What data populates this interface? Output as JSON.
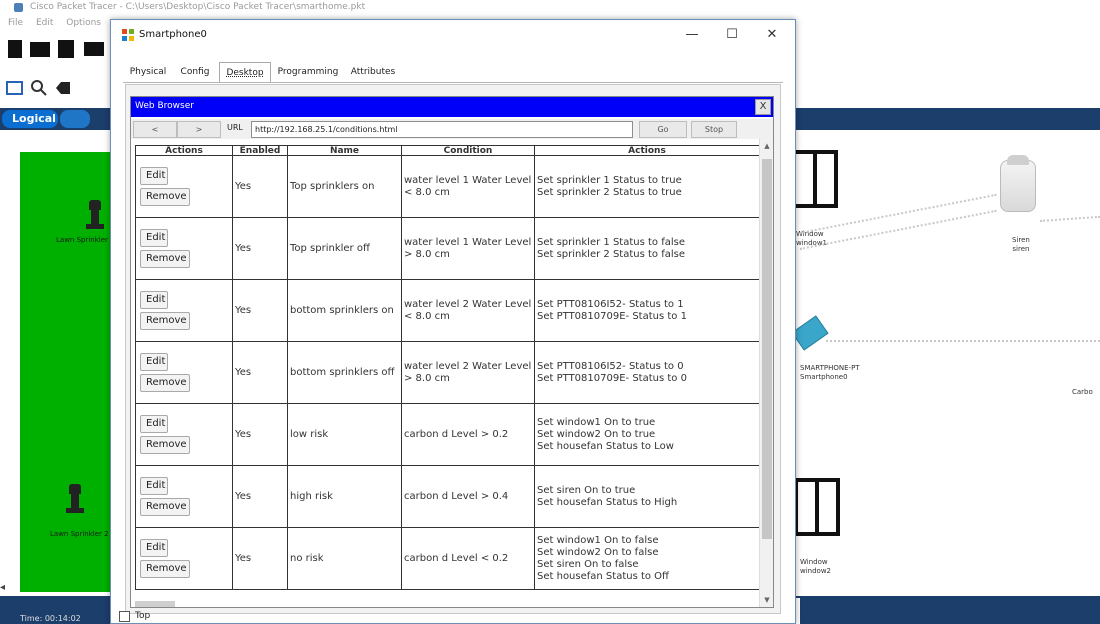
{
  "background": {
    "title_text": "Cisco Packet Tracer - C:\\Users\\Desktop\\Cisco Packet Tracer\\smarthome.pkt",
    "menu": [
      "File",
      "Edit",
      "Options"
    ],
    "logical_tab": "Logical",
    "devices": [
      {
        "label": "Lawn Sprinkler"
      },
      {
        "label": "Lawn Sprinkler 2"
      },
      {
        "label": "Window\nwindow1"
      },
      {
        "label": "Siren\nsiren"
      },
      {
        "label": "SMARTPHONE-PT\nSmartphone0"
      },
      {
        "label": "Carbo"
      },
      {
        "label": "Window\nwindow2"
      }
    ],
    "time_label": "Time: 00:14:02"
  },
  "window": {
    "title": "Smartphone0",
    "controls": {
      "minimize": "—",
      "maximize": "☐",
      "close": "✕"
    },
    "tabs": [
      "Physical",
      "Config",
      "Desktop",
      "Programming",
      "Attributes"
    ],
    "active_tab": "Desktop",
    "top_checkbox_label": "Top"
  },
  "browser": {
    "title": "Web Browser",
    "close": "X",
    "nav": {
      "back": "<",
      "forward": ">",
      "url_label": "URL",
      "go": "Go",
      "stop": "Stop"
    },
    "url": "http://192.168.25.1/conditions.html",
    "columns": [
      "Actions",
      "Enabled",
      "Name",
      "Condition",
      "Actions"
    ],
    "edit_label": "Edit",
    "remove_label": "Remove",
    "rules": [
      {
        "enabled": "Yes",
        "name": "Top sprinklers on",
        "condition": "water level 1 Water Level < 8.0 cm",
        "actions": "Set sprinkler 1 Status to true\nSet sprinkler 2 Status to true"
      },
      {
        "enabled": "Yes",
        "name": "Top sprinkler off",
        "condition": "water level 1 Water Level > 8.0 cm",
        "actions": "Set sprinkler 1 Status to false\nSet sprinkler 2 Status to false"
      },
      {
        "enabled": "Yes",
        "name": "bottom sprinklers on",
        "condition": "water level 2 Water Level < 8.0 cm",
        "actions": "Set PTT08106I52- Status to 1\nSet PTT0810709E- Status to 1"
      },
      {
        "enabled": "Yes",
        "name": "bottom sprinklers off",
        "condition": "water level 2 Water Level > 8.0 cm",
        "actions": "Set PTT08106I52- Status to 0\nSet PTT0810709E- Status to 0"
      },
      {
        "enabled": "Yes",
        "name": "low risk",
        "condition": "carbon d Level > 0.2",
        "actions": "Set window1 On to true\nSet window2 On to true\nSet housefan Status to Low"
      },
      {
        "enabled": "Yes",
        "name": "high risk",
        "condition": "carbon d Level > 0.4",
        "actions": "Set siren On to true\nSet housefan Status to High"
      },
      {
        "enabled": "Yes",
        "name": "no risk",
        "condition": "carbon d Level < 0.2",
        "actions": "Set window1 On to false\nSet window2 On to false\nSet siren On to false\nSet housefan Status to Off"
      }
    ]
  },
  "colors": {
    "browser_titlebar": "#0000f8",
    "green_area": "#00b000",
    "navy_bar": "#1c3e6b"
  }
}
